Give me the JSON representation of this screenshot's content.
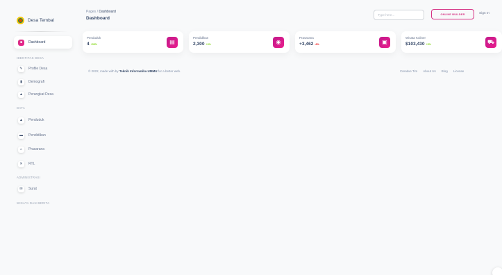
{
  "brand": {
    "name": "Desa Tembal"
  },
  "sidebar": {
    "active": {
      "label": "Dashboard",
      "icon": "dashboard-icon"
    },
    "sections": [
      {
        "label": "IDENTITAS DESA",
        "items": [
          {
            "label": "Profile Desa",
            "icon": "pencil-icon"
          },
          {
            "label": "Demografi",
            "icon": "chart-icon"
          },
          {
            "label": "Perangkat Desa",
            "icon": "users-icon"
          }
        ]
      },
      {
        "label": "DATA",
        "items": [
          {
            "label": "Penduduk",
            "icon": "people-icon"
          },
          {
            "label": "Pendidikan",
            "icon": "book-icon"
          },
          {
            "label": "Prasarana",
            "icon": "building-icon"
          },
          {
            "label": "RTL",
            "icon": "tools-icon"
          }
        ]
      },
      {
        "label": "ADMINISTRASI",
        "items": [
          {
            "label": "Surat",
            "icon": "mail-icon"
          }
        ]
      },
      {
        "label": "WISATA DAN BERITA",
        "items": []
      }
    ]
  },
  "header": {
    "breadcrumb_root": "Pages",
    "breadcrumb_separator": "/",
    "breadcrumb_current": "Dashboard",
    "title": "Dashboard",
    "search_placeholder": "Type here...",
    "builder_label": "ONLINE BUILDER",
    "signin_label": "Sign In"
  },
  "stats": [
    {
      "title": "Penduduk",
      "value": "4",
      "change": "+55%",
      "trend": "pos",
      "icon": "wallet-icon"
    },
    {
      "title": "Pendidikan",
      "value": "2,300",
      "change": "+3%",
      "trend": "pos",
      "icon": "globe-icon"
    },
    {
      "title": "Prasarana",
      "value": "+3,462",
      "change": "-2%",
      "trend": "neg",
      "icon": "document-icon"
    },
    {
      "title": "Wisata Kuliner",
      "value": "$103,430",
      "change": "+5%",
      "trend": "pos",
      "icon": "cart-icon"
    }
  ],
  "footer": {
    "copyright_prefix": "© 2022, made with by ",
    "author": "Teknik Informatika UMMU",
    "copyright_suffix": " for a better web.",
    "links": [
      "Creative Tim",
      "About Us",
      "Blog",
      "License"
    ]
  },
  "colors": {
    "accent": "#d63384",
    "text": "#344767",
    "muted": "#67748e",
    "positive": "#82d616",
    "negative": "#ea0606",
    "background": "#f8f9fa"
  }
}
